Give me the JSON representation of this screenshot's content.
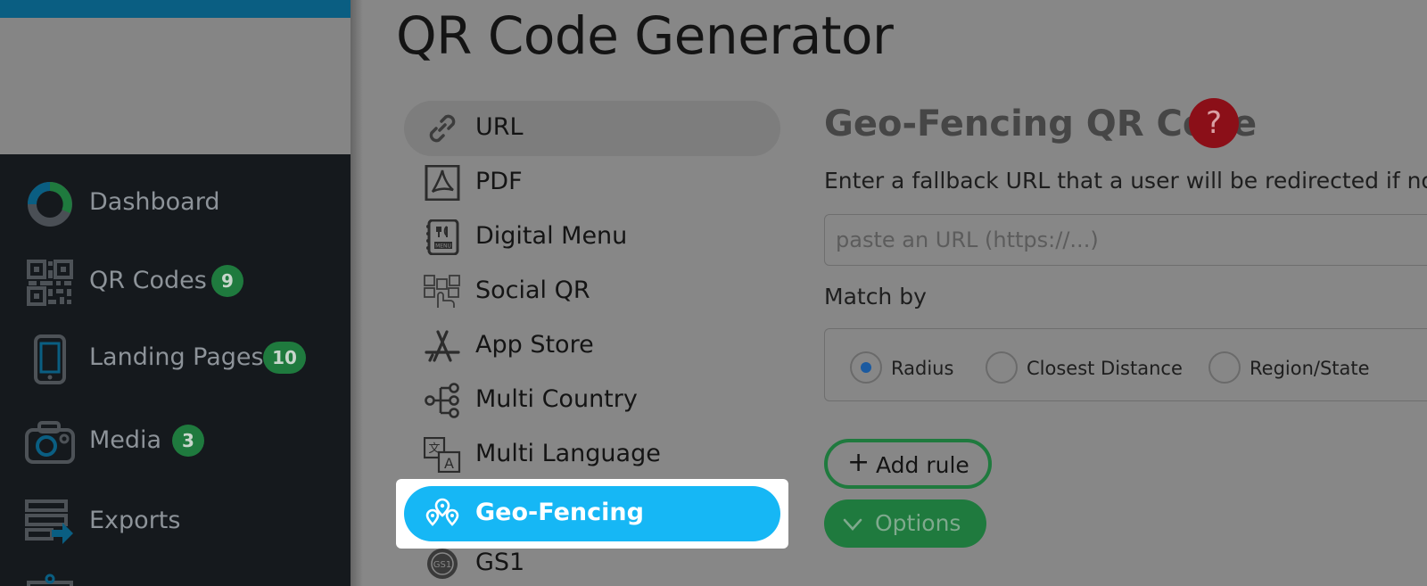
{
  "sidebar": {
    "items": [
      {
        "label": "Dashboard",
        "icon": "dashboard-donut-icon",
        "badge": null
      },
      {
        "label": "QR Codes",
        "icon": "qr-code-icon",
        "badge": "9"
      },
      {
        "label": "Landing Pages",
        "icon": "smartphone-icon",
        "badge": "10"
      },
      {
        "label": "Media",
        "icon": "camera-icon",
        "badge": "3"
      },
      {
        "label": "Exports",
        "icon": "export-icon",
        "badge": null
      }
    ]
  },
  "page": {
    "title": "QR Code Generator"
  },
  "qr_types": [
    {
      "label": "URL",
      "icon": "link-icon"
    },
    {
      "label": "PDF",
      "icon": "pdf-icon"
    },
    {
      "label": "Digital Menu",
      "icon": "menu-icon"
    },
    {
      "label": "Social QR",
      "icon": "social-icon"
    },
    {
      "label": "App Store",
      "icon": "app-store-icon"
    },
    {
      "label": "Multi Country",
      "icon": "hierarchy-icon"
    },
    {
      "label": "Multi Language",
      "icon": "translate-icon"
    },
    {
      "label": "Geo-Fencing",
      "icon": "map-pins-icon"
    },
    {
      "label": "GS1",
      "icon": "gs1-icon"
    }
  ],
  "selected_type": "Geo-Fencing",
  "geo": {
    "title": "Geo-Fencing QR Code",
    "help": "?",
    "description": "Enter a fallback URL that a user will be redirected if no",
    "url_placeholder": "paste an URL (https://...)",
    "match_label": "Match by",
    "match_options": [
      {
        "label": "Radius",
        "checked": true
      },
      {
        "label": "Closest Distance",
        "checked": false
      },
      {
        "label": "Region/State",
        "checked": false
      }
    ],
    "add_rule": "Add rule",
    "options": "Options"
  },
  "colors": {
    "sidebar_bg": "#15191d",
    "badge_green": "#1f7a3e",
    "active_blue": "#16b7f5",
    "help_red": "#8b0f18",
    "top_bar": "#0a5e82"
  }
}
